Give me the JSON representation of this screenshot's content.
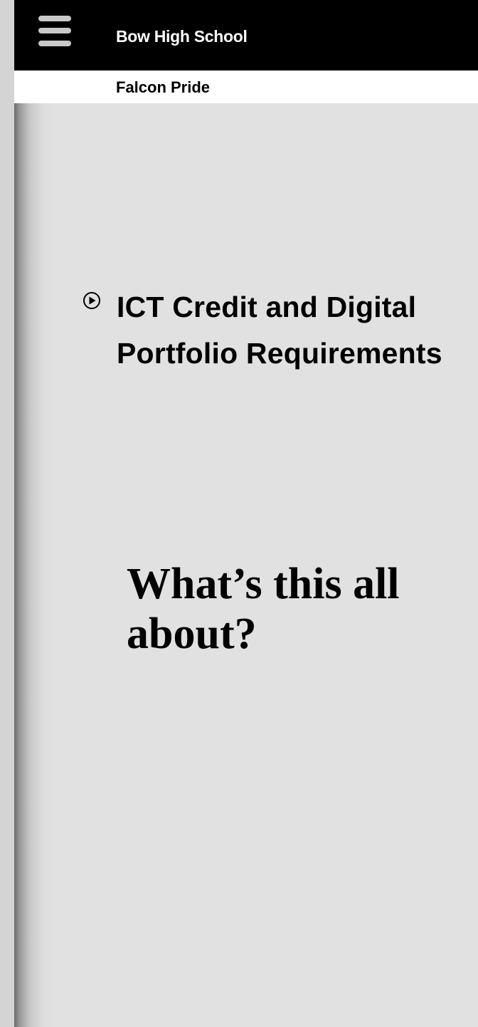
{
  "header": {
    "site_title": "Bow High School",
    "tagline": "Falcon Pride"
  },
  "main": {
    "link_title": "ICT Credit and Digital Portfolio Requirements",
    "question_heading": "What’s this all about?"
  },
  "icons": {
    "menu": "hamburger-menu-icon",
    "link_marker": "play-circle-icon"
  },
  "colors": {
    "header_bg": "#000000",
    "subheader_bg": "#ffffff",
    "content_bg": "#e1e1e1",
    "menu_bars": "#c9c9c9"
  }
}
